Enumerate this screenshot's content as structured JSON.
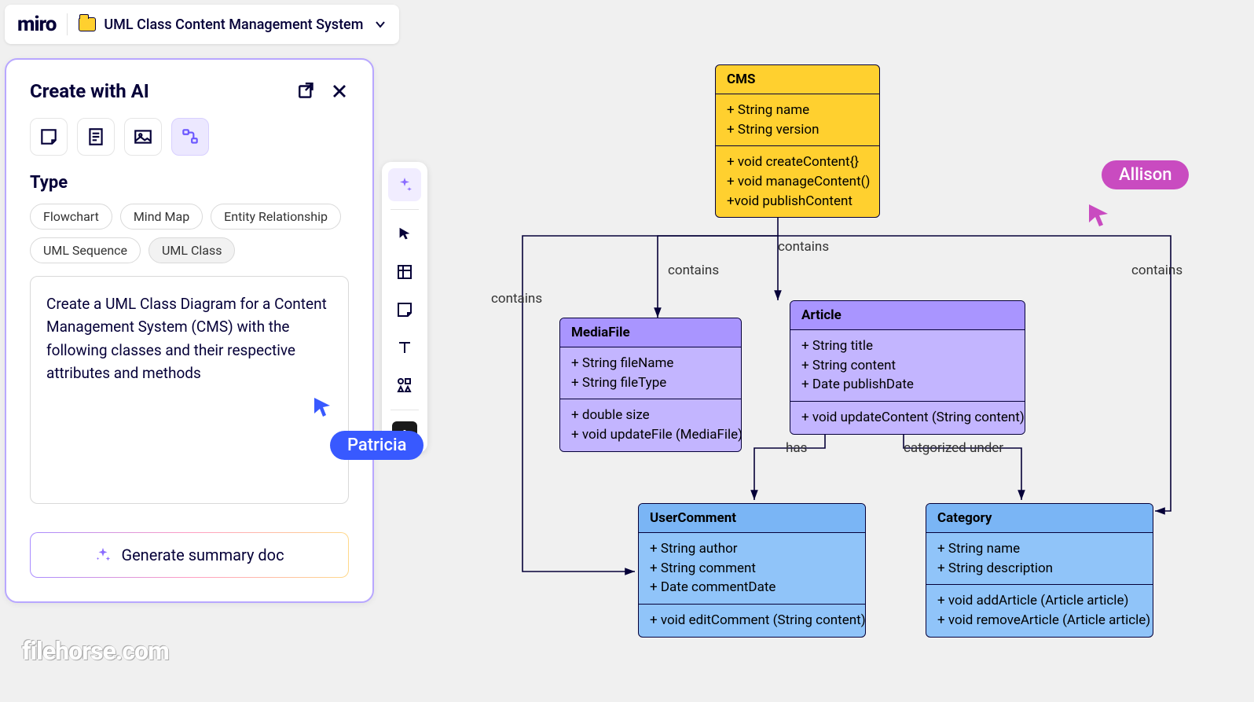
{
  "header": {
    "logo": "miro",
    "board_name": "UML Class Content Management System"
  },
  "ai_panel": {
    "title": "Create with AI",
    "type_label": "Type",
    "chips": [
      "Flowchart",
      "Mind Map",
      "Entity Relationship",
      "UML Sequence",
      "UML Class"
    ],
    "active_chip": "UML Class",
    "prompt": "Create a UML Class Diagram for a Content Management System (CMS) with the following classes and their respective attributes and methods",
    "generate_label": "Generate summary doc"
  },
  "toolbar_icons": [
    "sparkle",
    "cursor",
    "frame",
    "sticky",
    "text",
    "shapes",
    "add"
  ],
  "cursors": {
    "user1": "Patricia",
    "user2": "Allison"
  },
  "diagram": {
    "relations": {
      "r1": "contains",
      "r2": "contains",
      "r3": "contains",
      "r4": "contains",
      "r5": "has",
      "r6": "catgorized under"
    },
    "classes": {
      "cms": {
        "name": "CMS",
        "attrs": [
          "+ String name",
          "+ String version"
        ],
        "methods": [
          "+ void createContent{}",
          "+ void manageContent()",
          "+void publishContent"
        ]
      },
      "media": {
        "name": "MediaFile",
        "attrs": [
          "+ String fileName",
          "+ String fileType"
        ],
        "methods": [
          "+ double size",
          "+ void updateFile (MediaFile)"
        ]
      },
      "article": {
        "name": "Article",
        "attrs": [
          "+ String title",
          "+ String content",
          "+ Date publishDate"
        ],
        "methods": [
          "+ void updateContent (String content)"
        ]
      },
      "comment": {
        "name": "UserComment",
        "attrs": [
          "+ String author",
          "+ String comment",
          "+ Date commentDate"
        ],
        "methods": [
          "+ void editComment (String content)"
        ]
      },
      "category": {
        "name": "Category",
        "attrs": [
          "+ String name",
          "+ String description"
        ],
        "methods": [
          "+ void addArticle (Article article)",
          "+ void removeArticle (Article article)"
        ]
      }
    }
  },
  "watermark": "filehorse.com"
}
